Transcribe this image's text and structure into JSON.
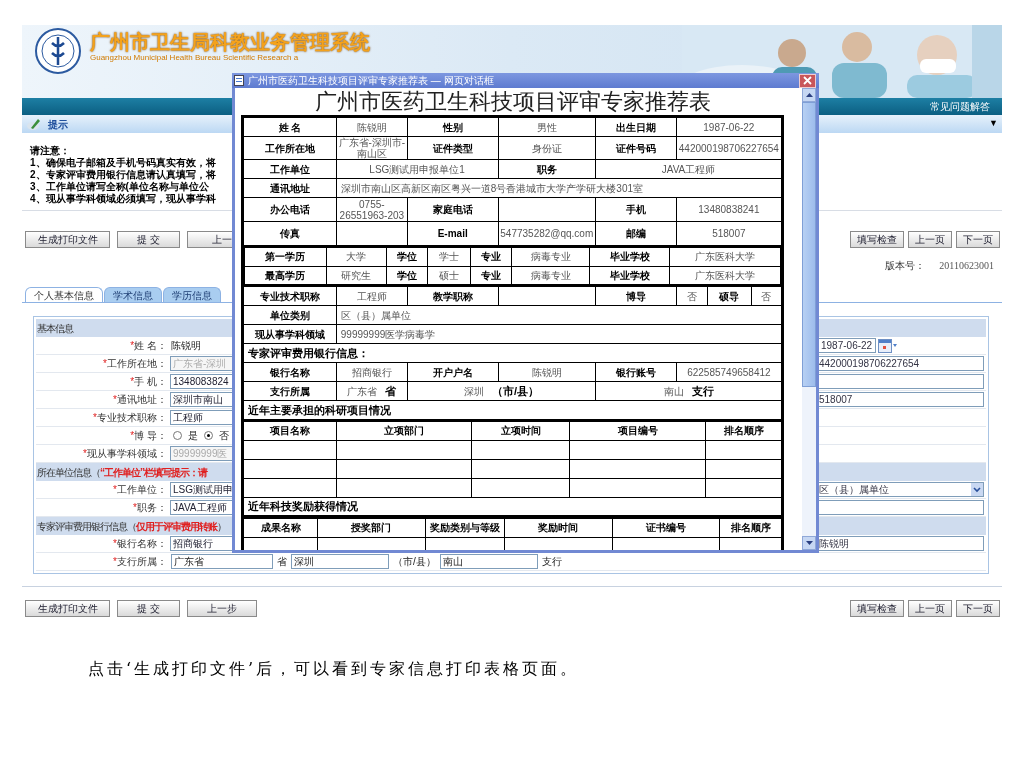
{
  "banner": {
    "title": "广州市卫生局科教业务管理系统",
    "subtitle": "Guangzhou Municipal Health Bureau Scientific Research a",
    "nav_link": "常见问题解答"
  },
  "tip_bar": {
    "title": "提示",
    "toggle": "▼"
  },
  "notes": {
    "heading": "请注意：",
    "items": [
      "1、确保电子邮箱及手机号码真实有效，将",
      "2、专家评审费用银行信息请认真填写，将",
      "3、工作单位请写全称(单位名称与单位公",
      "4、现从事学科领域必须填写，现从事学科"
    ]
  },
  "top_buttons": [
    "生成打印文件",
    "提 交",
    "上一"
  ],
  "right_buttons": [
    "填写检查",
    "上一页",
    "下一页"
  ],
  "version": {
    "label": "版本号：",
    "value": "20110623001"
  },
  "tabs": [
    {
      "label": "个人基本信息",
      "selected": true
    },
    {
      "label": "学术信息",
      "selected": false
    },
    {
      "label": "学历信息",
      "selected": false
    }
  ],
  "form": {
    "sections": [
      {
        "title": "基本信息",
        "rows": [
          {
            "mark": "*",
            "label": "姓 名：",
            "value": {
              "kind": "text",
              "text": "陈锐明"
            },
            "right": {
              "kind": "date",
              "text": "1987-06-22"
            }
          },
          {
            "mark": "*",
            "label": "工作所在地：",
            "value": {
              "kind": "input",
              "text": "广东省-深圳",
              "disabled": true
            },
            "right": {
              "kind": "input",
              "text": "442000198706227654"
            }
          },
          {
            "mark": "*",
            "label": "手 机：",
            "value": {
              "kind": "input",
              "text": "1348083824",
              "disabled": false
            },
            "right": {
              "kind": "input"
            }
          },
          {
            "mark": "*",
            "label": "通讯地址：",
            "value": {
              "kind": "input",
              "text": "深圳市南山",
              "disabled": false
            },
            "right": {
              "kind": "input",
              "text": "518007"
            }
          },
          {
            "mark": "*",
            "label": "专业技术职称：",
            "value": {
              "kind": "input",
              "text": "工程师",
              "disabled": false
            }
          },
          {
            "mark": "*",
            "label": "博 导：",
            "value": {
              "kind": "radio",
              "options": [
                {
                  "label": "是",
                  "selected": false
                },
                {
                  "label": "否",
                  "selected": true
                }
              ]
            }
          },
          {
            "mark": "*",
            "label": "现从事学科领域：",
            "value": {
              "kind": "input",
              "text": "99999999医",
              "disabled": true
            }
          }
        ]
      },
      {
        "title": "所在单位信息（",
        "note": "“工作单位”栏填写提示：请",
        "rows": [
          {
            "mark": "*",
            "label": "工作单位：",
            "value": {
              "kind": "input",
              "text": "LSG测试用申",
              "disabled": false
            },
            "right": {
              "kind": "select",
              "text": "区（县）属单位"
            }
          },
          {
            "mark": "*",
            "label": "职务：",
            "value": {
              "kind": "input",
              "text": "JAVA工程师",
              "disabled": false
            },
            "right": {
              "kind": "input"
            }
          }
        ]
      },
      {
        "title": "专家评审费用银行信息（",
        "note": "仅用于评审费用转账",
        "title_end": "）",
        "rows": [
          {
            "mark": "*",
            "label": "银行名称：",
            "value": {
              "kind": "input",
              "text": "招商银行",
              "disabled": false
            },
            "right": {
              "kind": "input",
              "text": "陈锐明"
            }
          },
          {
            "mark": "*",
            "label": "支行所属：",
            "value": {
              "kind": "branch",
              "text": "广东省",
              "province": "省",
              "city": "深圳",
              "city_unit": "（市/县）",
              "branch": "南山",
              "branch_unit": "支行"
            }
          }
        ]
      }
    ]
  },
  "bottom_buttons": [
    "生成打印文件",
    "提 交",
    "上一步"
  ],
  "bottom_right_buttons": [
    "填写检查",
    "上一页",
    "下一页"
  ],
  "dialog": {
    "title": "广州市医药卫生科技项目评审专家推荐表 — 网页对话框",
    "heading": "广州市医药卫生科技项目评审专家推荐表",
    "blocks": [
      {
        "kind": "main",
        "rows": [
          {
            "kind": "six",
            "fields": [
              {
                "label": "姓 名",
                "value": "陈锐明"
              },
              {
                "label": "性别",
                "value": "男性"
              },
              {
                "label": "出生日期",
                "value": "1987-06-22"
              }
            ]
          },
          {
            "kind": "six",
            "fields": [
              {
                "label": "工作所在地",
                "value": "广东省-深圳市-南山区"
              },
              {
                "label": "证件类型",
                "value": "身份证"
              },
              {
                "label": "证件号码",
                "value": "442000198706227654"
              }
            ]
          },
          {
            "kind": "split",
            "fields": [
              {
                "label": "工作单位",
                "value": "LSG测试用申报单位1"
              },
              {
                "label": "职务",
                "value": "JAVA工程师"
              }
            ]
          },
          {
            "kind": "wide",
            "fields": [
              {
                "label": "通讯地址",
                "value": "深圳市南山区高新区南区粤兴一道8号香港城市大学产学研大楼301室"
              }
            ]
          },
          {
            "kind": "six",
            "fields": [
              {
                "label": "办公电话",
                "value": "0755-26551963-203"
              },
              {
                "label": "家庭电话"
              },
              {
                "label": "手机",
                "value": "13480838241"
              }
            ]
          },
          {
            "kind": "six",
            "fields": [
              {
                "label": "传真"
              },
              {
                "label": "E-mail",
                "value": "547735282@qq.com"
              },
              {
                "label": "邮编",
                "value": "518007"
              }
            ]
          }
        ]
      },
      {
        "kind": "edu",
        "rows": [
          {
            "kind": "plain",
            "fields": [
              {
                "label": "第一学历",
                "value": "大学"
              },
              {
                "label": "学位",
                "value": "学士"
              },
              {
                "label": "专业",
                "value": "病毒专业"
              },
              {
                "label": "毕业学校",
                "value": "广东医科大学"
              }
            ]
          },
          {
            "kind": "plain",
            "fields": [
              {
                "label": "最高学历",
                "value": "研究生"
              },
              {
                "label": "学位",
                "value": "硕士"
              },
              {
                "label": "专业",
                "value": "病毒专业"
              },
              {
                "label": "毕业学校",
                "value": "广东医科大学"
              }
            ]
          }
        ]
      },
      {
        "kind": "main",
        "rows": [
          {
            "kind": "plain",
            "fields": [
              {
                "label": "专业技术职称",
                "value": "工程师"
              },
              {
                "label": "教学职称"
              },
              {
                "label": "博导",
                "value": "否"
              },
              {
                "label": "硕导",
                "value": "否"
              }
            ]
          },
          {
            "kind": "wide",
            "fields": [
              {
                "label": "单位类别",
                "value": "区（县）属单位"
              }
            ]
          },
          {
            "kind": "wide",
            "fields": [
              {
                "label": "现从事学科领域",
                "value": "99999999医学病毒学"
              }
            ]
          },
          {
            "kind": "full",
            "heading": "专家评审费用银行信息："
          },
          {
            "kind": "six",
            "fields": [
              {
                "label": "银行名称",
                "value": "招商银行"
              },
              {
                "label": "开户户名",
                "value": "陈锐明"
              },
              {
                "label": "银行账号",
                "value": "622585749658412"
              }
            ]
          },
          {
            "kind": "branch",
            "label": "支行所属",
            "parts": [
              {
                "value": "广东省",
                "unit": "省"
              },
              {
                "value": "深圳",
                "unit": "（市/县）"
              },
              {
                "value": "南山",
                "unit": "支行"
              }
            ]
          },
          {
            "kind": "full",
            "heading": "近年主要承担的科研项目情况"
          }
        ]
      },
      {
        "kind": "projects",
        "rows": [
          {
            "kind": "header",
            "columns": [
              "项目名称",
              "立项部门",
              "立项时间",
              "项目编号",
              "排名顺序"
            ]
          },
          {
            "kind": "blank"
          },
          {
            "kind": "blank"
          },
          {
            "kind": "blank"
          },
          {
            "kind": "full",
            "heading": "近年科技奖励获得情况"
          }
        ]
      },
      {
        "kind": "awards",
        "rows": [
          {
            "kind": "header",
            "columns": [
              "成果名称",
              "授奖部门",
              "奖励类别与等级",
              "奖励时间",
              "证书编号",
              "排名顺序"
            ]
          },
          {
            "kind": "blank"
          }
        ]
      }
    ]
  },
  "caption": "点击‘生成打印文件’后，可以看到专家信息打印表格页面。"
}
